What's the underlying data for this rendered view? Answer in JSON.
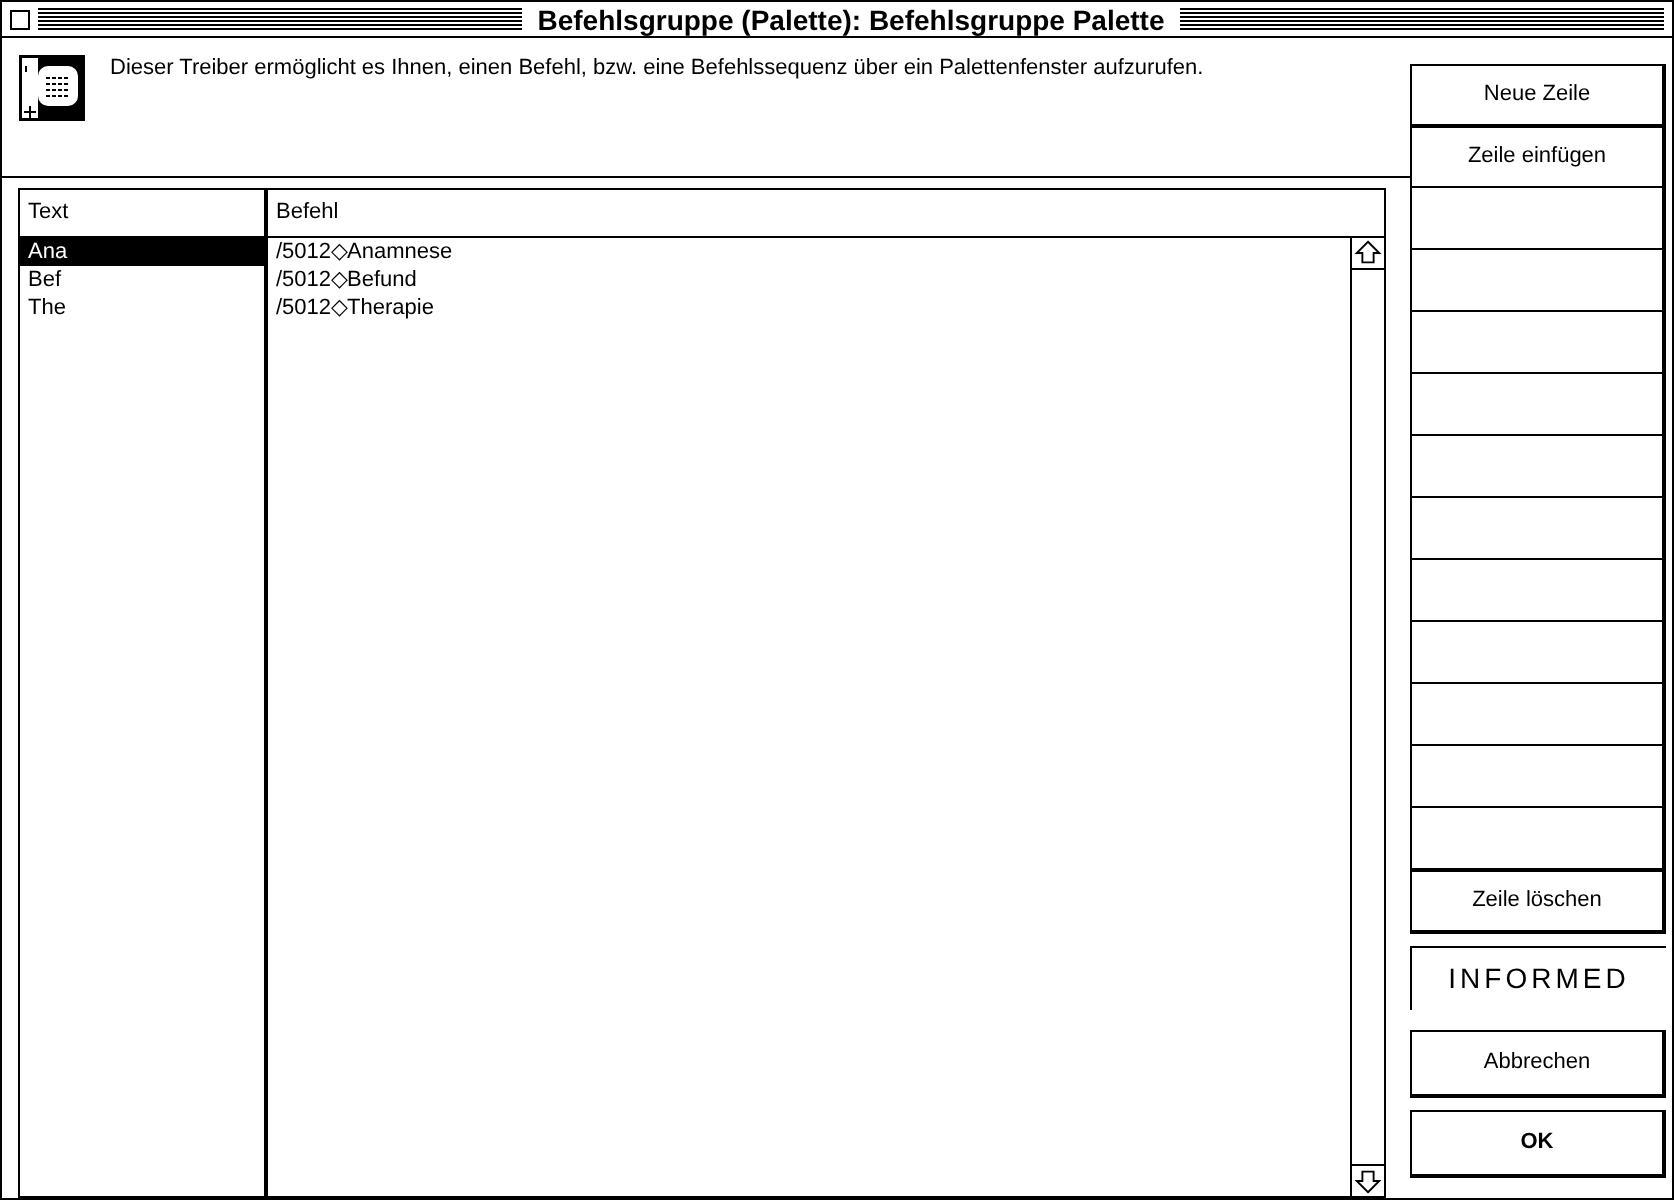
{
  "window": {
    "title": "Befehlsgruppe (Palette): Befehlsgruppe Palette"
  },
  "description": "Dieser Treiber ermöglicht es Ihnen, einen Befehl, bzw. eine Befehlssequenz über ein Palettenfenster aufzurufen.",
  "table": {
    "columns": [
      "Text",
      "Befehl"
    ],
    "rows": [
      {
        "text": "Ana",
        "command": "/5012◇Anamnese",
        "selected": true
      },
      {
        "text": "Bef",
        "command": "/5012◇Befund",
        "selected": false
      },
      {
        "text": "The",
        "command": "/5012◇Therapie",
        "selected": false
      }
    ]
  },
  "side_buttons": [
    {
      "kind": "labeled",
      "label": "Neue Zeile"
    },
    {
      "kind": "labeled",
      "label": "Zeile einfügen"
    },
    {
      "kind": "blank"
    },
    {
      "kind": "blank"
    },
    {
      "kind": "blank"
    },
    {
      "kind": "blank"
    },
    {
      "kind": "blank"
    },
    {
      "kind": "blank"
    },
    {
      "kind": "blank"
    },
    {
      "kind": "blank"
    },
    {
      "kind": "blank"
    },
    {
      "kind": "blank"
    },
    {
      "kind": "blank"
    },
    {
      "kind": "labeled",
      "label": "Zeile löschen"
    }
  ],
  "logo": "INFORMED",
  "cancel_button": "Abbrechen",
  "ok_button": "OK"
}
